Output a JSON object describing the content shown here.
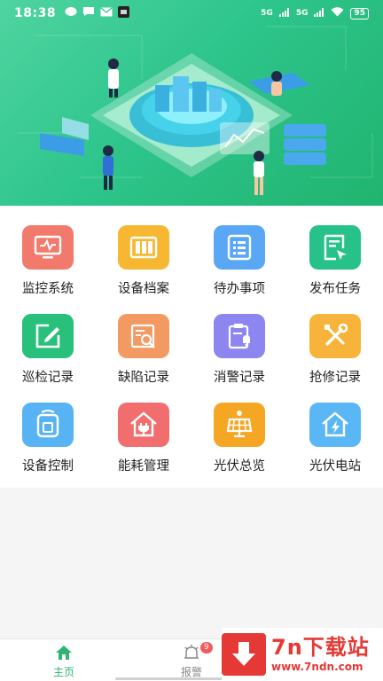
{
  "status_bar": {
    "time": "18:38",
    "network": "5G",
    "network2": "5G",
    "battery": "95",
    "icons": [
      "chat-icon",
      "message-icon",
      "mail-icon",
      "app-icon",
      "wifi-icon",
      "battery-icon"
    ]
  },
  "banner": {
    "illustration": "isometric smart-energy monitoring platform with people"
  },
  "modules": [
    {
      "label": "监控系统",
      "color": "#f27a6c",
      "icon": "monitor-icon"
    },
    {
      "label": "设备档案",
      "color": "#f7b731",
      "icon": "archive-icon"
    },
    {
      "label": "待办事项",
      "color": "#5aa7f5",
      "icon": "todo-list-icon"
    },
    {
      "label": "发布任务",
      "color": "#26c28a",
      "icon": "publish-task-icon"
    },
    {
      "label": "巡检记录",
      "color": "#29c07b",
      "icon": "inspection-edit-icon"
    },
    {
      "label": "缺陷记录",
      "color": "#f39a63",
      "icon": "defect-search-icon"
    },
    {
      "label": "消警记录",
      "color": "#8d86f0",
      "icon": "alarm-clipboard-icon"
    },
    {
      "label": "抢修记录",
      "color": "#f7b33a",
      "icon": "repair-tools-icon"
    },
    {
      "label": "设备控制",
      "color": "#58b3f4",
      "icon": "device-control-icon"
    },
    {
      "label": "能耗管理",
      "color": "#f26d6d",
      "icon": "energy-house-icon"
    },
    {
      "label": "光伏总览",
      "color": "#f5a623",
      "icon": "solar-panel-icon"
    },
    {
      "label": "光伏电站",
      "color": "#5ab7f5",
      "icon": "power-station-icon"
    }
  ],
  "tabs": [
    {
      "label": "主页",
      "icon": "home-icon",
      "active": true
    },
    {
      "label": "报警",
      "icon": "alarm-bell-icon",
      "badge": "9"
    }
  ],
  "watermark": {
    "title": "7n下载站",
    "url": "www.7ndn.com"
  },
  "colors": {
    "accent": "#2fb56f",
    "banner": "#2ec58c"
  }
}
